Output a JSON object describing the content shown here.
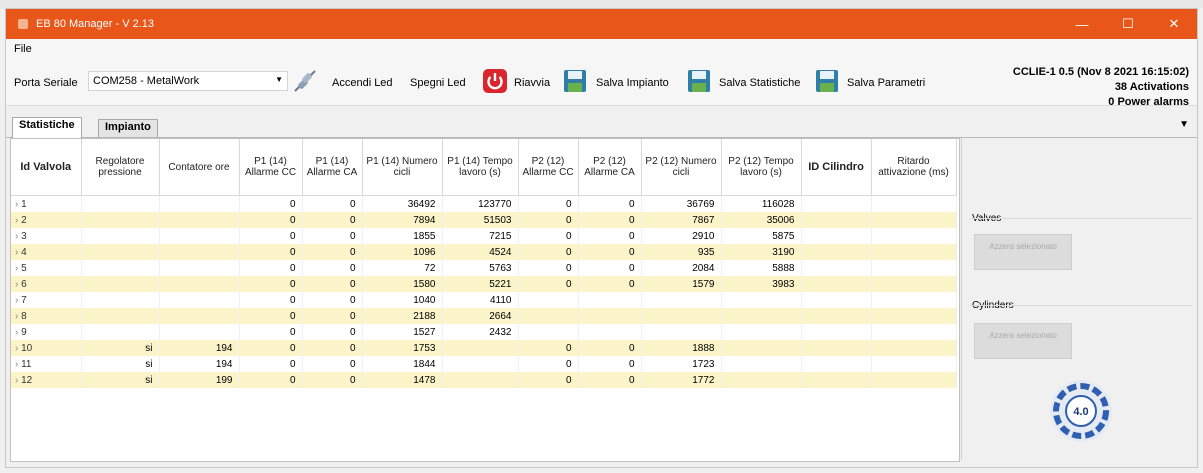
{
  "window": {
    "title": "EB 80 Manager - V 2.13"
  },
  "menu": {
    "items": [
      "File"
    ]
  },
  "toolbar": {
    "port_label": "Porta Seriale",
    "port_value": "COM258 - MetalWork",
    "accendi_led": "Accendi Led",
    "spegni_led": "Spegni Led",
    "riavvia": "Riavvia",
    "salva_impianto": "Salva Impianto",
    "salva_statistiche": "Salva Statistiche",
    "salva_parametri": "Salva Parametri"
  },
  "status": {
    "line1": "CCLIE-1 0.5 (Nov  8 2021 16:15:02)",
    "line2": "38 Activations",
    "line3": "0 Power alarms"
  },
  "tabs": [
    "Statistiche",
    "Impianto"
  ],
  "table": {
    "headers": [
      "Id Valvola",
      "Regolatore pressione",
      "Contatore ore",
      "P1 (14) Allarme CC",
      "P1 (14) Allarme CA",
      "P1 (14) Numero cicli",
      "P1 (14) Tempo lavoro (s)",
      "P2 (12) Allarme CC",
      "P2 (12) Allarme CA",
      "P2 (12) Numero cicli",
      "P2 (12) Tempo lavoro (s)",
      "ID Cilindro",
      "Ritardo attivazione (ms)"
    ],
    "rows": [
      [
        "1",
        "",
        "",
        "0",
        "0",
        "36492",
        "123770",
        "0",
        "0",
        "36769",
        "116028",
        "",
        ""
      ],
      [
        "2",
        "",
        "",
        "0",
        "0",
        "7894",
        "51503",
        "0",
        "0",
        "7867",
        "35006",
        "",
        ""
      ],
      [
        "3",
        "",
        "",
        "0",
        "0",
        "1855",
        "7215",
        "0",
        "0",
        "2910",
        "5875",
        "",
        ""
      ],
      [
        "4",
        "",
        "",
        "0",
        "0",
        "1096",
        "4524",
        "0",
        "0",
        "935",
        "3190",
        "",
        ""
      ],
      [
        "5",
        "",
        "",
        "0",
        "0",
        "72",
        "5763",
        "0",
        "0",
        "2084",
        "5888",
        "",
        ""
      ],
      [
        "6",
        "",
        "",
        "0",
        "0",
        "1580",
        "5221",
        "0",
        "0",
        "1579",
        "3983",
        "",
        ""
      ],
      [
        "7",
        "",
        "",
        "0",
        "0",
        "1040",
        "4110",
        "",
        "",
        "",
        "",
        "",
        ""
      ],
      [
        "8",
        "",
        "",
        "0",
        "0",
        "2188",
        "2664",
        "",
        "",
        "",
        "",
        "",
        ""
      ],
      [
        "9",
        "",
        "",
        "0",
        "0",
        "1527",
        "2432",
        "",
        "",
        "",
        "",
        "",
        ""
      ],
      [
        "10",
        "si",
        "194",
        "0",
        "0",
        "1753",
        "",
        "0",
        "0",
        "1888",
        "",
        "",
        ""
      ],
      [
        "11",
        "si",
        "194",
        "0",
        "0",
        "1844",
        "",
        "0",
        "0",
        "1723",
        "",
        "",
        ""
      ],
      [
        "12",
        "si",
        "199",
        "0",
        "0",
        "1478",
        "",
        "0",
        "0",
        "1772",
        "",
        "",
        ""
      ]
    ]
  },
  "side": {
    "valves_label": "Valves",
    "cylinders_label": "Cylinders",
    "azzera_button": "Azzera selezionato",
    "badge_text": "4.0"
  }
}
